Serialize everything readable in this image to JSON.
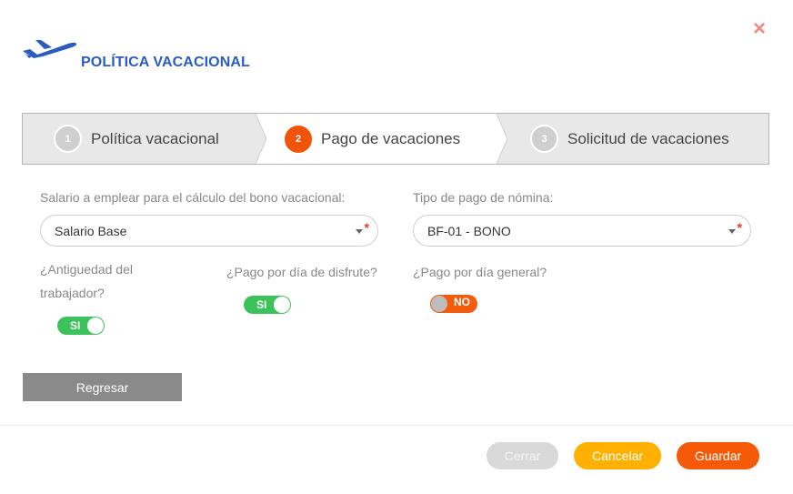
{
  "header": {
    "title": "POLÍTICA VACACIONAL",
    "close_glyph": "×",
    "logo_icon": "airplane-icon",
    "accent_color": "#2a5dbd"
  },
  "stepper": {
    "steps": [
      {
        "number": "1",
        "label": "Política vacacional",
        "state": "inactive"
      },
      {
        "number": "2",
        "label": "Pago de vacaciones",
        "state": "active"
      },
      {
        "number": "3",
        "label": "Solicitud de vacaciones",
        "state": "inactive"
      }
    ],
    "active_color": "#f0540a"
  },
  "form": {
    "salary": {
      "label": "Salario a emplear para el cálculo del bono vacacional:",
      "value": "Salario Base",
      "required_mark": "*"
    },
    "payroll_type": {
      "label": "Tipo de pago de nómina:",
      "value": "BF-01 - BONO",
      "required_mark": "*"
    },
    "seniority": {
      "label_line1": "¿Antiguedad del",
      "label_line2": "trabajador?",
      "state": "on",
      "text": "SI"
    },
    "pay_per_day_enjoyed": {
      "label": "¿Pago por día de disfrute?",
      "state": "on",
      "text": "SI"
    },
    "pay_per_day_general": {
      "label": "¿Pago por día general?",
      "state": "off",
      "text": "NO"
    }
  },
  "actions": {
    "back_label": "Regresar",
    "close_label": "Cerrar",
    "cancel_label": "Cancelar",
    "save_label": "Guardar",
    "on_color": "#3cc25a",
    "off_color": "#f25c0c",
    "cancel_color": "#ffb000",
    "save_color": "#f55a08"
  }
}
